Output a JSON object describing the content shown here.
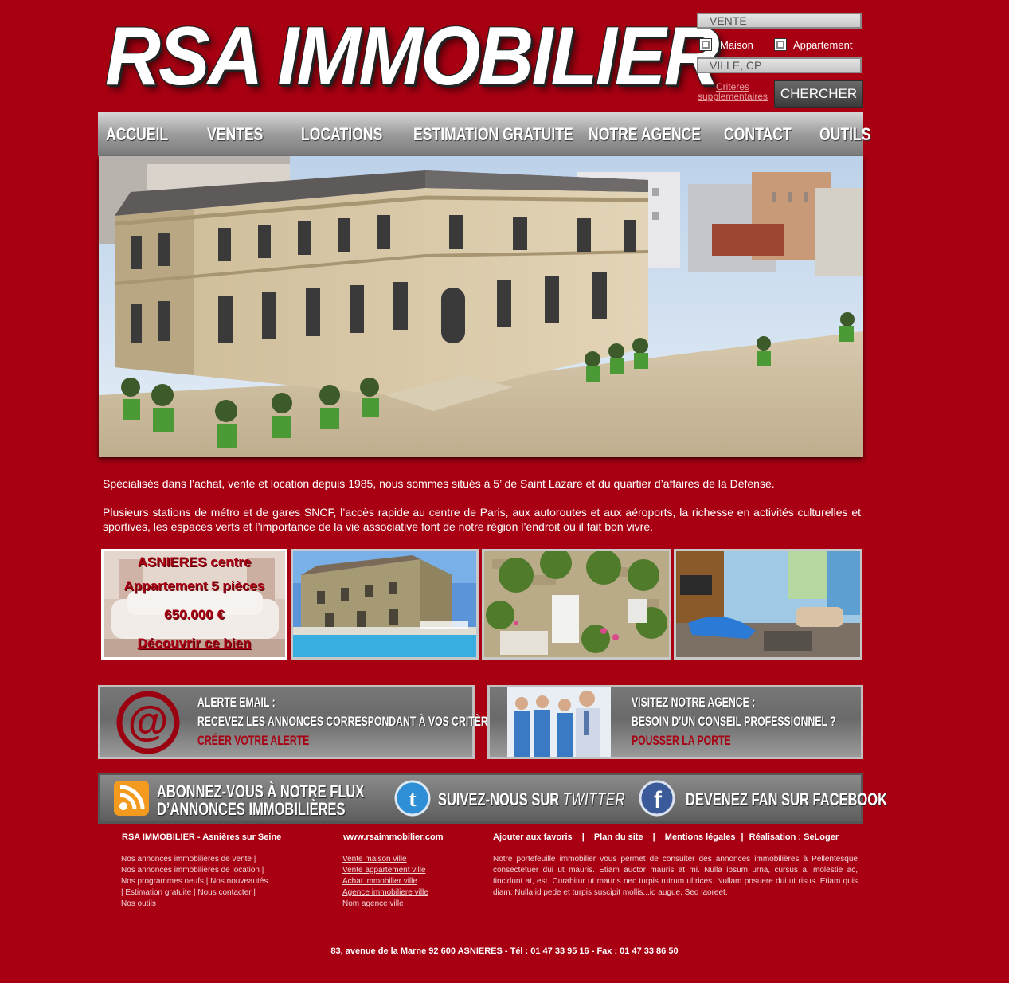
{
  "header": {
    "logo_text": "RSA IMMOBILIER",
    "search": {
      "transaction_value": "VENTE",
      "type_maison_label": "Maison",
      "type_appartement_label": "Appartement",
      "location_placeholder": "VILLE, CP",
      "criteria_link_line1": "Critères",
      "criteria_link_line2": "supplementaires",
      "submit_label": "CHERCHER"
    }
  },
  "nav": {
    "items": [
      {
        "label": "ACCUEIL"
      },
      {
        "label": "VENTES"
      },
      {
        "label": "LOCATIONS"
      },
      {
        "label": "ESTIMATION GRATUITE"
      },
      {
        "label": "NOTRE AGENCE"
      },
      {
        "label": "CONTACT"
      },
      {
        "label": "OUTILS"
      }
    ]
  },
  "intro": {
    "paragraph1": "Spécialisés dans l’achat, vente et location depuis 1985, nous sommes situés à 5’ de Saint Lazare et du quartier d’affaires de la Défense.",
    "paragraph2": "Plusieurs stations de métro et de gares SNCF, l’accès rapide au centre de Paris, aux autoroutes et aux aéroports, la richesse en activités culturelles et sportives, les espaces verts et l’importance de la vie associative font de notre région l’endroit où il fait bon vivre."
  },
  "featured": {
    "location": "ASNIERES centre",
    "type": "Appartement 5 pièces",
    "price": "650.000 €",
    "cta": "Découvrir ce bien"
  },
  "alert": {
    "title": "ALERTE EMAIL :",
    "subtitle": "RECEVEZ LES ANNONCES CORRESPONDANT À VOS CRITÈRES",
    "link": "CRÉER VOTRE ALERTE"
  },
  "visit": {
    "title": "VISITEZ NOTRE AGENCE :",
    "subtitle": "BESOIN D’UN CONSEIL PROFESSIONNEL ?",
    "link": "POUSSER LA PORTE"
  },
  "social": {
    "rss_line1": "ABONNEZ-VOUS À NOTRE FLUX",
    "rss_line2": "D’ANNONCES IMMOBILIÈRES",
    "twitter_prefix": "SUIVEZ-NOUS SUR",
    "twitter_brand": "TWITTER",
    "facebook": "DEVENEZ FAN SUR FACEBOOK"
  },
  "footer": {
    "col1_title": "RSA IMMOBILIER - Asnières sur Seine",
    "col1_lines": [
      "Nos annonces immobilières de vente |",
      "Nos annonces immobilières de location |",
      "Nos programmes neufs | Nos nouveautés",
      "| Estimation gratuite | Nous contacter |",
      "Nos outils"
    ],
    "col2_title": "www.rsaimmobilier.com",
    "col2_links": [
      "Vente maison ville",
      "Vente appartement ville",
      "Achat immobilier ville",
      "Agence immobiliere ville",
      "Nom agence ville"
    ],
    "col3_links": {
      "favoris": "Ajouter aux favoris",
      "plan": "Plan du site",
      "mentions": "Mentions légales",
      "realisation": "Réalisation : SeLoger"
    },
    "separator": "|",
    "col3_text": "Notre portefeuille immobilier vous permet de consulter des annonces immobilières à Pellentesque consectetuer dui ut mauris. Etiam auctor mauris at mi. Nulla ipsum urna, cursus a, molestie ac, tincidunt at, est. Curabitur ut mauris nec turpis rutrum ultrices. Nullam posuere dui ut risus. Etiam quis diam. Nulla id pede et turpis suscipit mollis...id augue. Sed laoreet.",
    "address": "83, avenue de la Marne 92 600 ASNIERES - Tél : 01 47 33 95 16 - Fax : 01 47 33 86 50"
  },
  "colors": {
    "background": "#a80012",
    "nav_gradient_top": "#d6d6d6",
    "nav_gradient_bottom": "#7a7a7a",
    "accent_red": "#a80012"
  }
}
